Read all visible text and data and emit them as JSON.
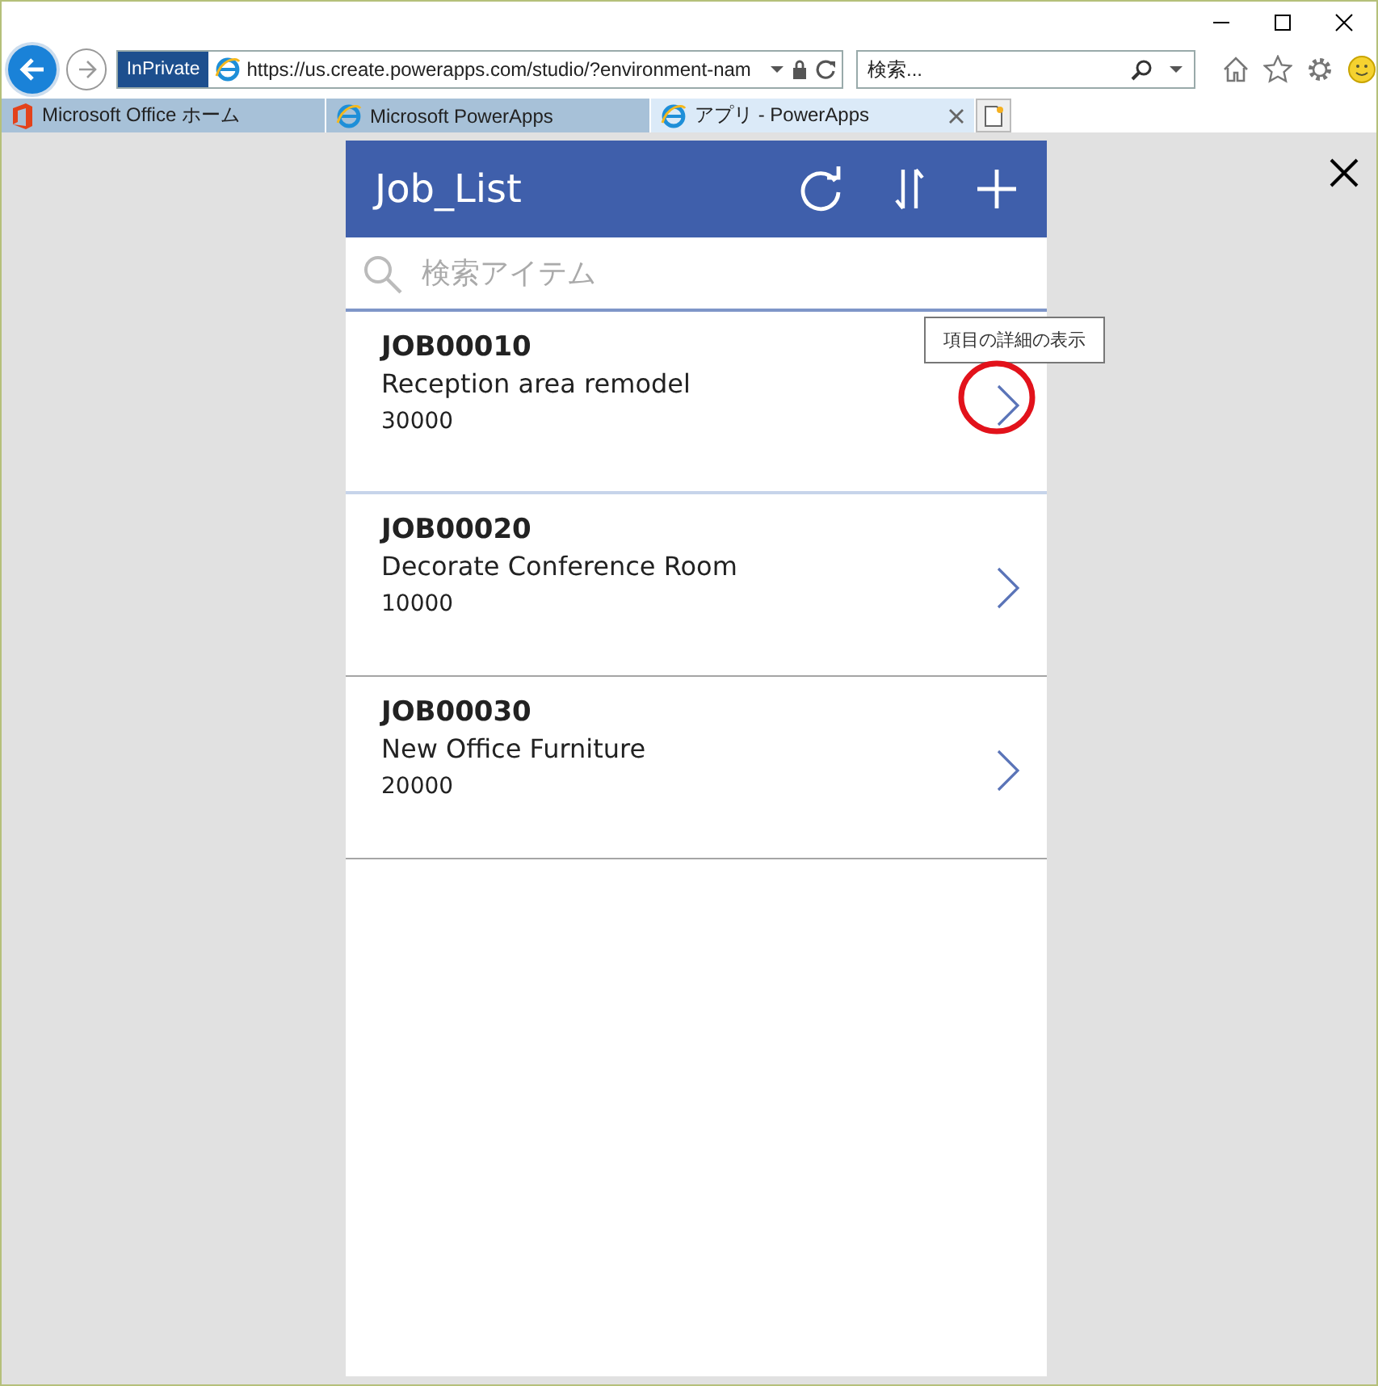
{
  "browser": {
    "inprivate_label": "InPrivate",
    "url": "https://us.create.powerapps.com/studio/?environment-nam",
    "search": {
      "placeholder": "検索..."
    },
    "tabs": [
      {
        "label": "Microsoft Office ホーム",
        "kind": "office",
        "selected": false
      },
      {
        "label": "Microsoft PowerApps",
        "kind": "ie",
        "selected": false
      },
      {
        "label": "アプリ - PowerApps",
        "kind": "ie",
        "selected": true
      }
    ]
  },
  "app": {
    "title": "Job_List",
    "search": {
      "placeholder": "検索アイテム"
    },
    "items": [
      {
        "id": "JOB00010",
        "title": "Reception area remodel",
        "amount": "30000",
        "selected": true
      },
      {
        "id": "JOB00020",
        "title": "Decorate Conference Room",
        "amount": "10000",
        "selected": false
      },
      {
        "id": "JOB00030",
        "title": "New Office Furniture",
        "amount": "20000",
        "selected": false
      }
    ],
    "tooltip": "項目の詳細の表示"
  }
}
